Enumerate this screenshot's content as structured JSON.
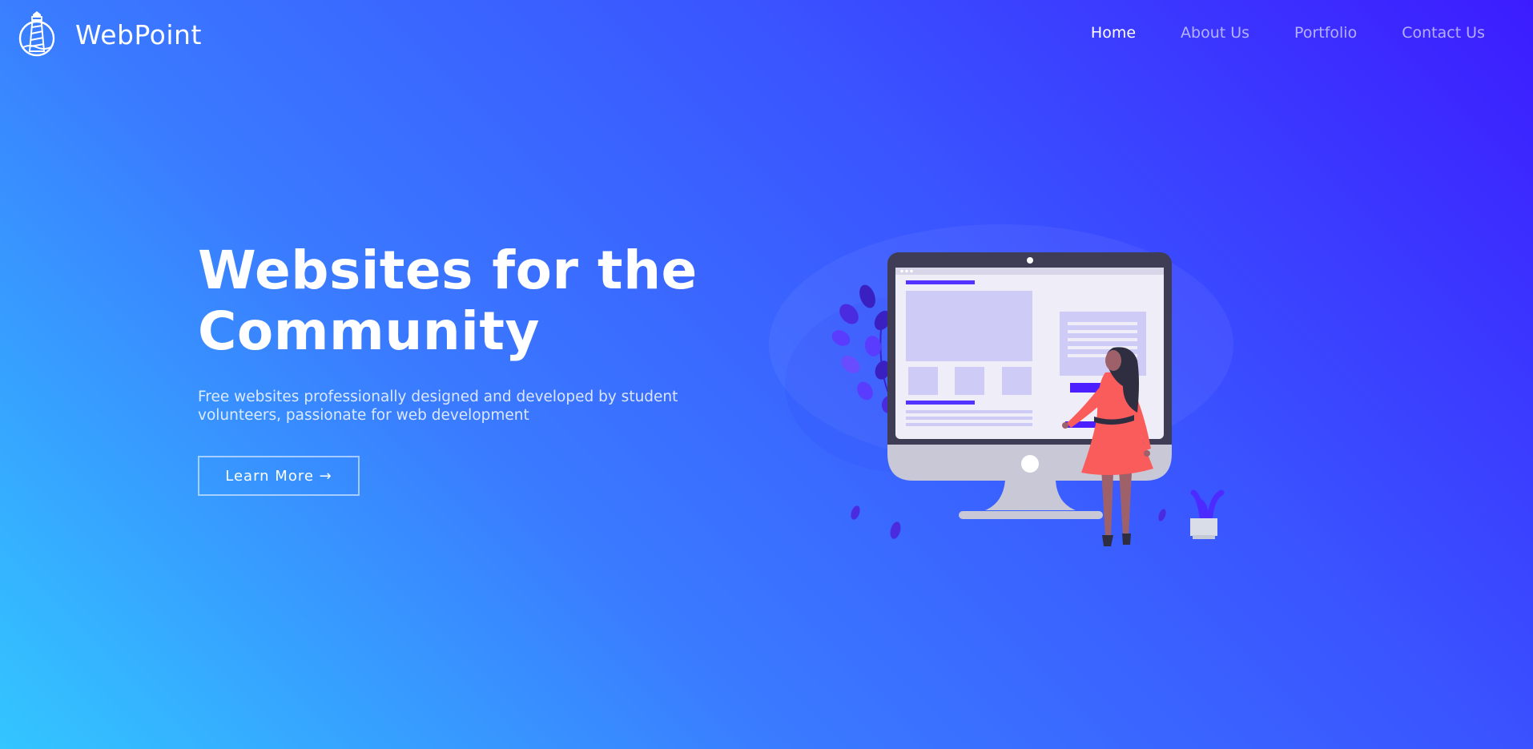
{
  "brand": {
    "name": "WebPoint",
    "logo_icon": "lighthouse-icon"
  },
  "nav": {
    "items": [
      {
        "label": "Home",
        "active": true
      },
      {
        "label": "About Us",
        "active": false
      },
      {
        "label": "Portfolio",
        "active": false
      },
      {
        "label": "Contact Us",
        "active": false
      }
    ]
  },
  "hero": {
    "title_line1": "Websites for the",
    "title_line2": "Community",
    "subtitle": "Free websites professionally designed and developed by student volunteers, passionate for web development",
    "cta_label": "Learn More →"
  },
  "illustration": {
    "name": "woman-at-monitor-illustration"
  },
  "colors": {
    "gradient_top_right": "#3c1cff",
    "gradient_bottom_left": "#33c6ff",
    "accent_purple": "#4b2bff",
    "dress": "#fa5b5b"
  }
}
